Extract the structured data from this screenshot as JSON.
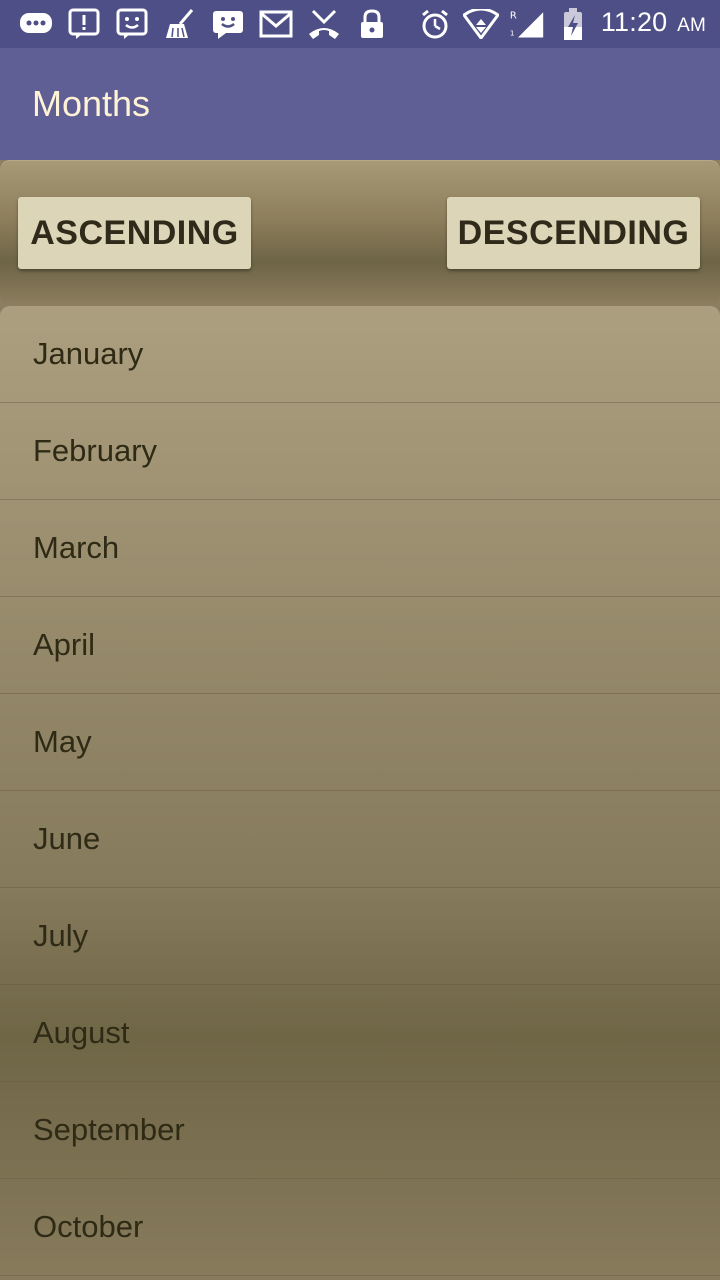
{
  "status_bar": {
    "time": "11:20",
    "ampm": "AM",
    "icons_left": [
      "chat-bubble-icon",
      "alert-message-icon",
      "smiley-message-icon",
      "broom-icon",
      "chat-bubble-icon",
      "gmail-icon",
      "missed-call-icon",
      "lock-icon"
    ],
    "icons_right": [
      "alarm-icon",
      "wifi-icon",
      "signal-icon",
      "battery-icon"
    ]
  },
  "toolbar": {
    "title": "Months",
    "color": "#5f5f96"
  },
  "buttons": {
    "ascending_label": "ASCENDING",
    "descending_label": "DESCENDING"
  },
  "months": {
    "items": [
      "January",
      "February",
      "March",
      "April",
      "May",
      "June",
      "July",
      "August",
      "September",
      "October"
    ]
  }
}
